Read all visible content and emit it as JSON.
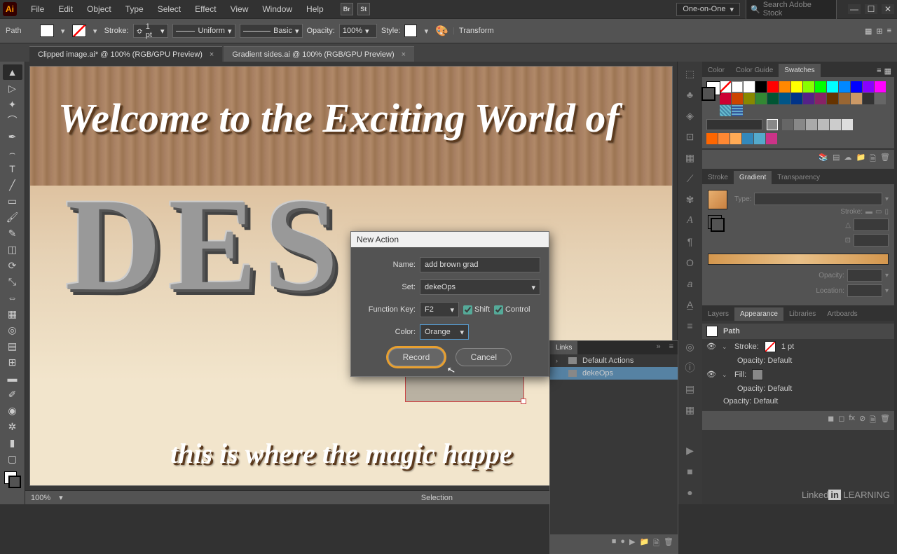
{
  "app": {
    "logo": "Ai"
  },
  "menu": {
    "items": [
      "File",
      "Edit",
      "Object",
      "Type",
      "Select",
      "Effect",
      "View",
      "Window",
      "Help"
    ]
  },
  "topright": {
    "workspace": "One-on-One",
    "search_placeholder": "Search Adobe Stock"
  },
  "control": {
    "selection_type": "Path",
    "stroke_label": "Stroke:",
    "stroke_weight": "1 pt",
    "brush": "Uniform",
    "style": "Basic",
    "opacity_label": "Opacity:",
    "opacity": "100%",
    "style_label": "Style:",
    "transform_label": "Transform"
  },
  "tabs": {
    "active": "Clipped image.ai* @ 100% (RGB/GPU Preview)",
    "inactive": "Gradient sides.ai @ 100% (RGB/GPU Preview)"
  },
  "canvas": {
    "line1": "Welcome to the Exciting World of",
    "line2": "this is where the magic happe",
    "big": [
      "D",
      "E",
      "S"
    ]
  },
  "dialog": {
    "title": "New Action",
    "name_label": "Name:",
    "name_value": "add brown grad",
    "set_label": "Set:",
    "set_value": "dekeOps",
    "fkey_label": "Function Key:",
    "fkey_value": "F2",
    "shift_label": "Shift",
    "control_label": "Control",
    "color_label": "Color:",
    "color_value": "Orange",
    "record": "Record",
    "cancel": "Cancel"
  },
  "actions_panel": {
    "tab": "Links",
    "item1": "Default Actions",
    "item2": "dekeOps"
  },
  "swatches": {
    "tab1": "Color",
    "tab2": "Color Guide",
    "tab3": "Swatches"
  },
  "gradient": {
    "tab1": "Stroke",
    "tab2": "Gradient",
    "tab3": "Transparency",
    "type_label": "Type:",
    "stroke_label": "Stroke:",
    "opacity_label": "Opacity:",
    "location_label": "Location:"
  },
  "appearance": {
    "tab1": "Layers",
    "tab2": "Appearance",
    "tab3": "Libraries",
    "tab4": "Artboards",
    "head": "Path",
    "stroke_label": "Stroke:",
    "stroke_val": "1 pt",
    "opacity_def": "Opacity: Default",
    "fill_label": "Fill:"
  },
  "status": {
    "zoom": "100%",
    "mode": "Selection"
  },
  "footer": {
    "brand": "Linked",
    "in": "in",
    "learning": " LEARNING"
  }
}
